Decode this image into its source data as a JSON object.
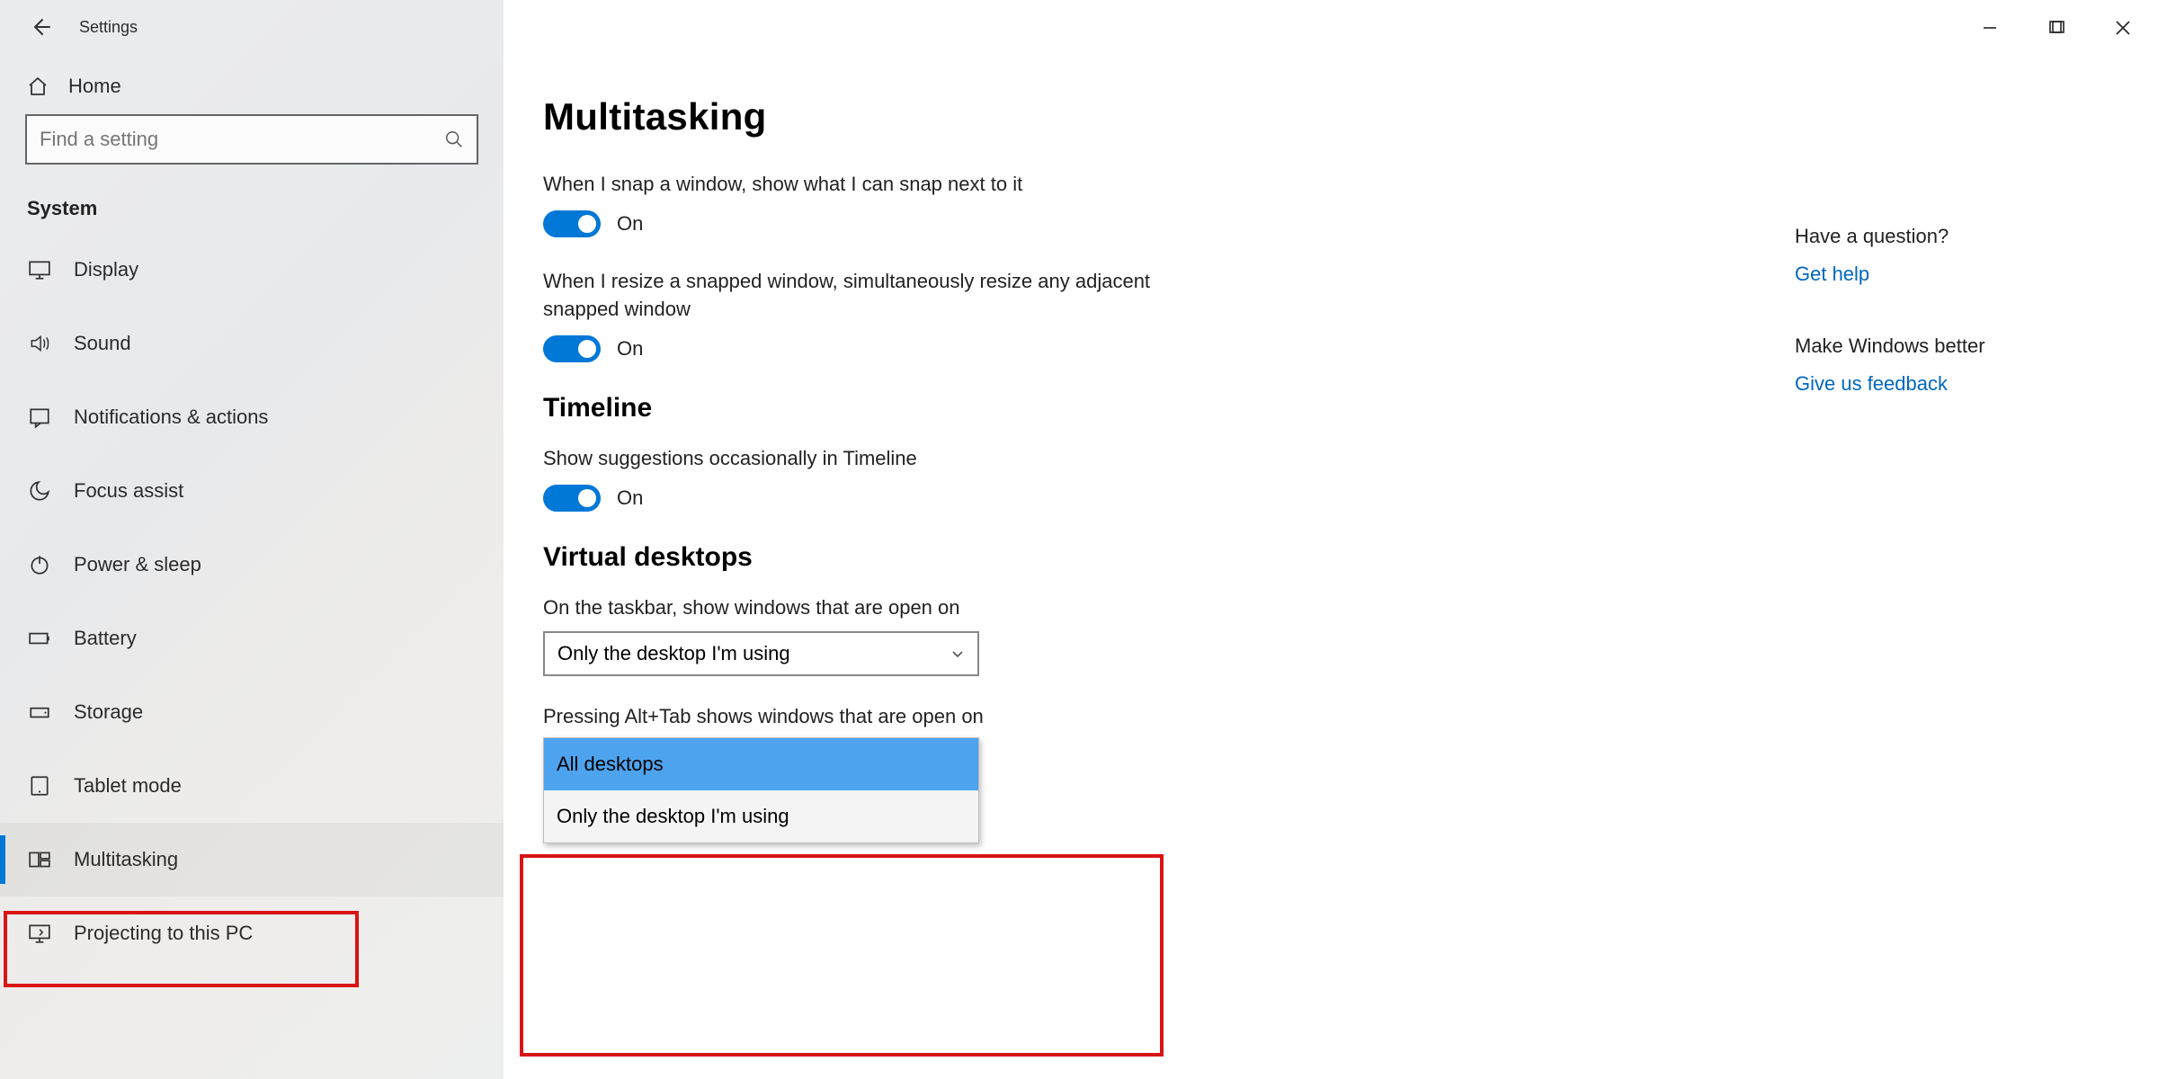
{
  "app_title": "Settings",
  "home_label": "Home",
  "search_placeholder": "Find a setting",
  "category": "System",
  "sidebar_items": [
    {
      "label": "Display",
      "icon": "display"
    },
    {
      "label": "Sound",
      "icon": "sound"
    },
    {
      "label": "Notifications & actions",
      "icon": "notify"
    },
    {
      "label": "Focus assist",
      "icon": "focus"
    },
    {
      "label": "Power & sleep",
      "icon": "power"
    },
    {
      "label": "Battery",
      "icon": "battery"
    },
    {
      "label": "Storage",
      "icon": "storage"
    },
    {
      "label": "Tablet mode",
      "icon": "tablet"
    },
    {
      "label": "Multitasking",
      "icon": "multitask"
    },
    {
      "label": "Projecting to this PC",
      "icon": "project"
    }
  ],
  "active_index": 8,
  "page_title": "Multitasking",
  "snap1_desc": "When I snap a window, show what I can snap next to it",
  "snap2_desc": "When I resize a snapped window, simultaneously resize any adjacent snapped window",
  "timeline_heading": "Timeline",
  "timeline_desc": "Show suggestions occasionally in Timeline",
  "vd_heading": "Virtual desktops",
  "vd_taskbar_desc": "On the taskbar, show windows that are open on",
  "vd_taskbar_value": "Only the desktop I'm using",
  "vd_alttab_desc": "Pressing Alt+Tab shows windows that are open on",
  "vd_alttab_options": [
    "All desktops",
    "Only the desktop I'm using"
  ],
  "toggle_on": "On",
  "right_rail": {
    "q_head": "Have a question?",
    "q_link": "Get help",
    "fb_head": "Make Windows better",
    "fb_link": "Give us feedback"
  }
}
